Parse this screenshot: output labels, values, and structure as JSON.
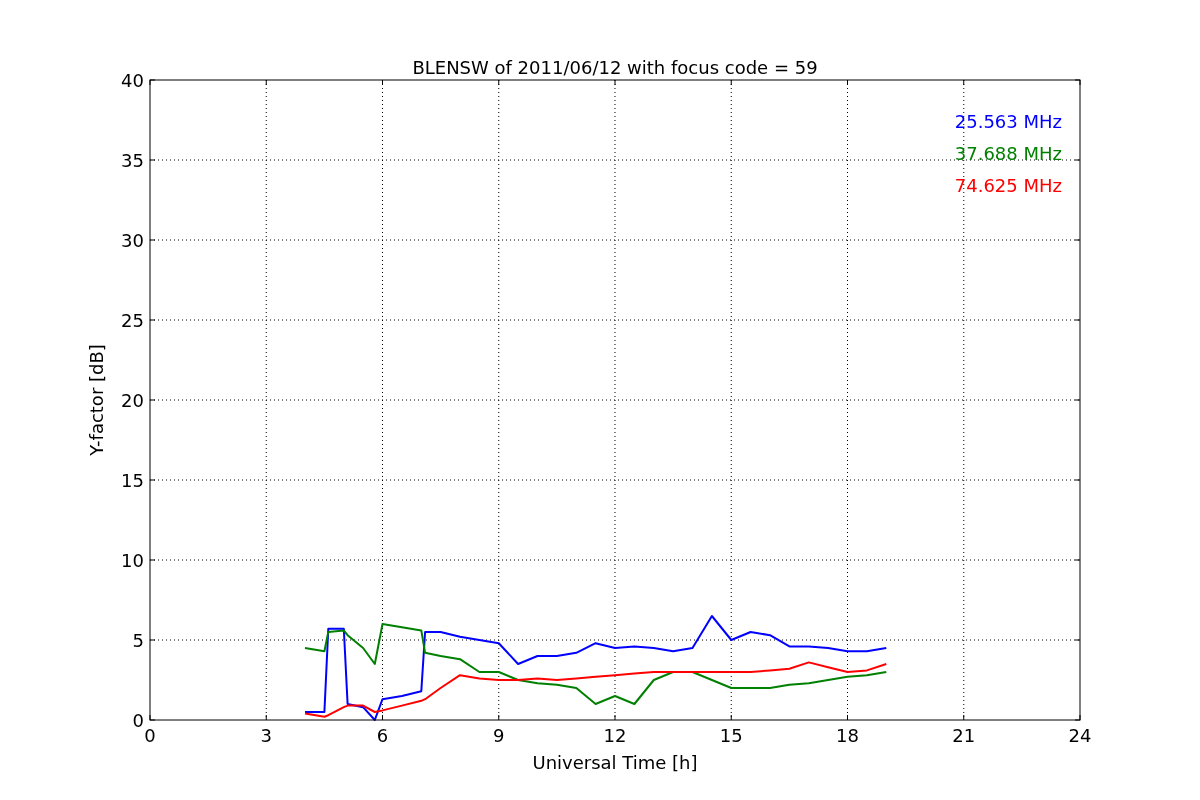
{
  "figure": {
    "chart_data": {
      "type": "line",
      "title": "BLENSW of 2011/06/12 with focus code = 59",
      "xlabel": "Universal Time [h]",
      "ylabel": "Y-factor [dB]",
      "x": [
        4,
        4.5,
        4.6,
        5,
        5.1,
        5.5,
        5.8,
        6,
        6.5,
        7,
        7.1,
        7.5,
        8,
        8.5,
        9,
        9.5,
        10,
        10.5,
        11,
        11.5,
        12,
        12.5,
        13,
        13.5,
        14,
        14.5,
        15,
        15.5,
        16,
        16.5,
        17,
        17.5,
        18,
        18.5,
        19
      ],
      "series": [
        {
          "name": "25.563 MHz",
          "color": "#0000ff",
          "values": [
            0.5,
            0.5,
            5.7,
            5.7,
            1,
            0.8,
            0,
            1.3,
            1.5,
            1.8,
            5.5,
            5.5,
            5.2,
            5,
            4.8,
            3.5,
            4,
            4,
            4.2,
            4.8,
            4.5,
            4.6,
            4.5,
            4.3,
            4.5,
            6.5,
            5,
            5.5,
            5.3,
            4.6,
            4.6,
            4.5,
            4.3,
            4.3,
            4.5
          ]
        },
        {
          "name": "37.688 MHz",
          "color": "#008000",
          "values": [
            4.5,
            4.3,
            5.5,
            5.6,
            5.3,
            4.5,
            3.5,
            6,
            5.8,
            5.6,
            4.2,
            4,
            3.8,
            3,
            3,
            2.5,
            2.3,
            2.2,
            2,
            1,
            1.5,
            1,
            2.5,
            3,
            3,
            2.5,
            2,
            2,
            2,
            2.2,
            2.3,
            2.5,
            2.7,
            2.8,
            3
          ]
        },
        {
          "name": "74.625 MHz",
          "color": "#ff0000",
          "values": [
            0.4,
            0.2,
            0.3,
            0.8,
            0.9,
            0.9,
            0.5,
            0.6,
            0.9,
            1.2,
            1.3,
            2,
            2.8,
            2.6,
            2.5,
            2.5,
            2.6,
            2.5,
            2.6,
            2.7,
            2.8,
            2.9,
            3,
            3,
            3,
            3,
            3,
            3,
            3.1,
            3.2,
            3.6,
            3.3,
            3,
            3.1,
            3.5
          ]
        }
      ],
      "grid": true,
      "xlim": [
        0,
        24
      ],
      "ylim": [
        0,
        40
      ],
      "xticks": [
        0,
        3,
        6,
        9,
        12,
        15,
        18,
        21,
        24
      ],
      "yticks": [
        0,
        5,
        10,
        15,
        20,
        25,
        30,
        35,
        40
      ]
    }
  }
}
